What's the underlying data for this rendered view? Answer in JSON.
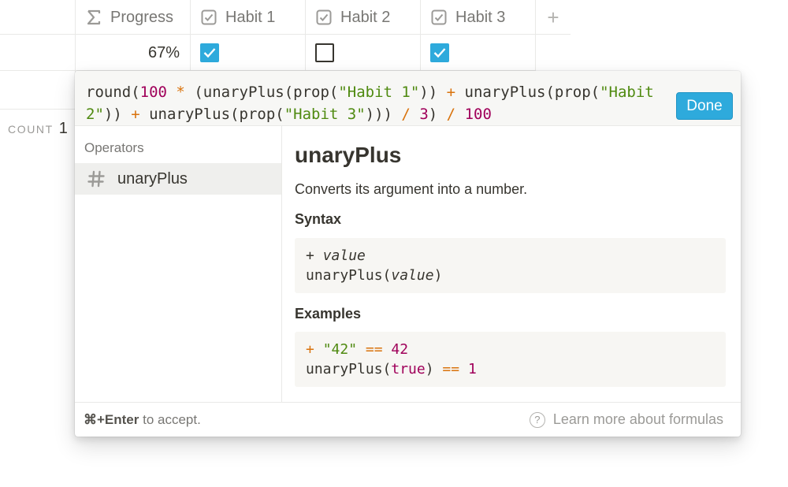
{
  "table": {
    "columns": [
      {
        "label": "Progress",
        "icon": "sigma-icon"
      },
      {
        "label": "Habit 1",
        "icon": "checkbox-icon"
      },
      {
        "label": "Habit 2",
        "icon": "checkbox-icon"
      },
      {
        "label": "Habit 3",
        "icon": "checkbox-icon"
      }
    ],
    "add_column": "+",
    "row": {
      "progress": "67%",
      "habit1": true,
      "habit2": false,
      "habit3": true
    },
    "count_label": "COUNT",
    "count_value": "1"
  },
  "formula_editor": {
    "tokens": [
      {
        "t": "round(",
        "k": "plain"
      },
      {
        "t": "100",
        "k": "num"
      },
      {
        "t": " ",
        "k": "plain"
      },
      {
        "t": "*",
        "k": "op"
      },
      {
        "t": " (unaryPlus(prop(",
        "k": "plain"
      },
      {
        "t": "\"Habit 1\"",
        "k": "str"
      },
      {
        "t": ")) ",
        "k": "plain"
      },
      {
        "t": "+",
        "k": "op"
      },
      {
        "t": " unaryPlus(prop(",
        "k": "plain"
      },
      {
        "t": "\"Habit\n2\"",
        "k": "str"
      },
      {
        "t": ")) ",
        "k": "plain"
      },
      {
        "t": "+",
        "k": "op"
      },
      {
        "t": " unaryPlus(prop(",
        "k": "plain"
      },
      {
        "t": "\"Habit 3\"",
        "k": "str"
      },
      {
        "t": "))) ",
        "k": "plain"
      },
      {
        "t": "/",
        "k": "op"
      },
      {
        "t": " ",
        "k": "plain"
      },
      {
        "t": "3",
        "k": "num"
      },
      {
        "t": ") ",
        "k": "plain"
      },
      {
        "t": "/",
        "k": "op"
      },
      {
        "t": " ",
        "k": "plain"
      },
      {
        "t": "100",
        "k": "num"
      }
    ],
    "done_label": "Done"
  },
  "sidebar": {
    "heading": "Operators",
    "items": [
      {
        "label": "unaryPlus",
        "icon": "hash-icon"
      }
    ]
  },
  "detail": {
    "title": "unaryPlus",
    "description": "Converts its argument into a number.",
    "syntax_heading": "Syntax",
    "syntax_lines": [
      [
        {
          "t": "+ ",
          "k": "plain"
        },
        {
          "t": "value",
          "k": "italic"
        }
      ],
      [
        {
          "t": "unaryPlus(",
          "k": "plain"
        },
        {
          "t": "value",
          "k": "italic"
        },
        {
          "t": ")",
          "k": "plain"
        }
      ]
    ],
    "examples_heading": "Examples",
    "example_lines": [
      [
        {
          "t": "+",
          "k": "op"
        },
        {
          "t": " ",
          "k": "plain"
        },
        {
          "t": "\"42\"",
          "k": "str"
        },
        {
          "t": " ",
          "k": "plain"
        },
        {
          "t": "==",
          "k": "op"
        },
        {
          "t": " ",
          "k": "plain"
        },
        {
          "t": "42",
          "k": "num"
        }
      ],
      [
        {
          "t": "unaryPlus(",
          "k": "plain"
        },
        {
          "t": "true",
          "k": "num"
        },
        {
          "t": ") ",
          "k": "plain"
        },
        {
          "t": "==",
          "k": "op"
        },
        {
          "t": " ",
          "k": "plain"
        },
        {
          "t": "1",
          "k": "num"
        }
      ]
    ]
  },
  "footer": {
    "shortcut": "⌘+Enter",
    "hint_rest": " to accept.",
    "learn_more": "Learn more about formulas",
    "help_icon": "question-circle-icon"
  },
  "colors": {
    "accent": "#2eaadc",
    "number": "#a0005a",
    "string": "#4f8a10",
    "operator": "#d9730d"
  }
}
